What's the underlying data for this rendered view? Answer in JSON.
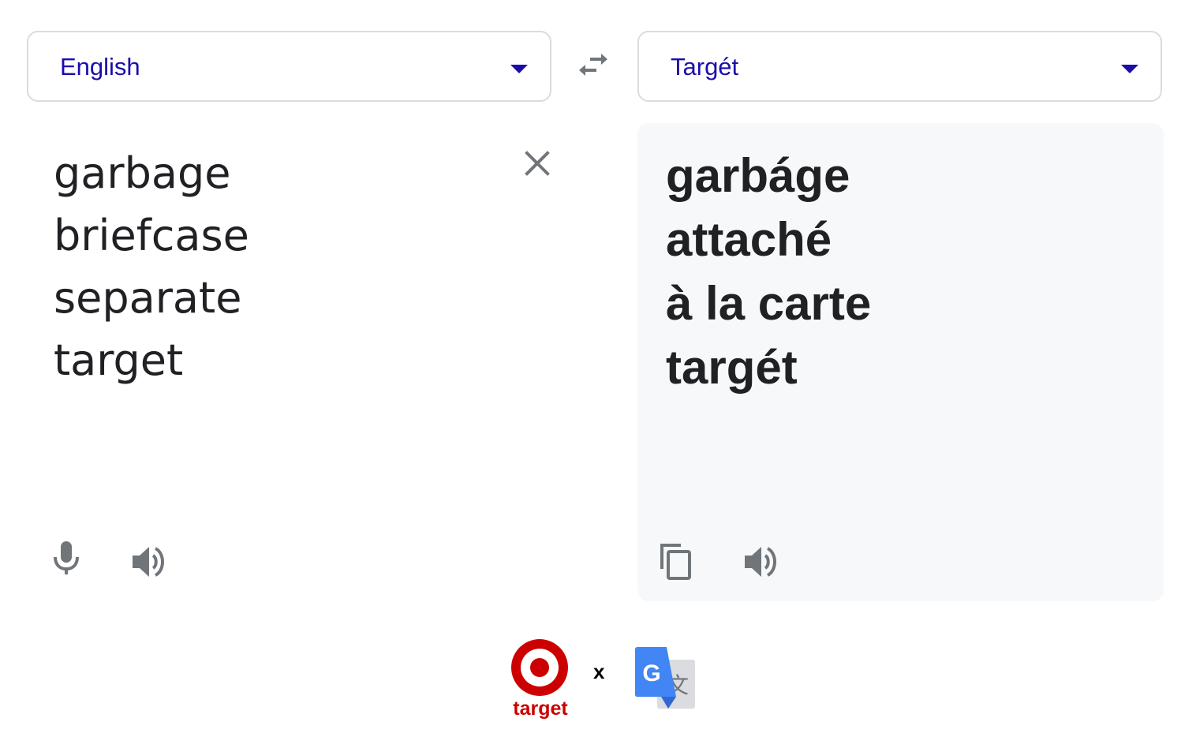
{
  "source_language": {
    "label": "English"
  },
  "target_language": {
    "label": "Targét"
  },
  "source_text": {
    "lines": [
      "garbage",
      "briefcase",
      "separate",
      "target"
    ]
  },
  "translation": {
    "lines": [
      "garbáge",
      "attaché",
      "à la carte",
      "targét"
    ]
  },
  "icons": {
    "swap": "swap-languages-icon",
    "clear": "close-icon",
    "mic": "microphone-icon",
    "speaker": "speaker-icon",
    "copy": "copy-icon"
  },
  "footer": {
    "brand_text": "target",
    "separator": "x"
  },
  "colors": {
    "accent": "#1a0dab",
    "icon_gray": "#70757a",
    "panel_bg": "#f7f8fa",
    "target_red": "#cc0000",
    "google_blue": "#4285f4"
  }
}
